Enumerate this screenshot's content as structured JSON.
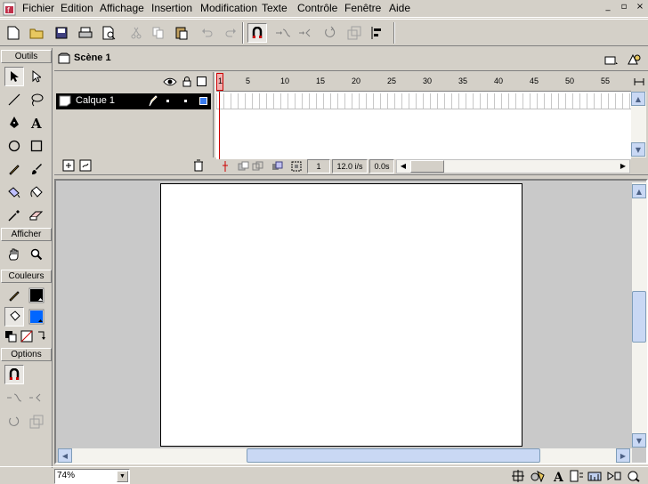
{
  "menu": {
    "items": [
      "Fichier",
      "Edition",
      "Affichage",
      "Insertion",
      "Modification",
      "Texte",
      "Contrôle",
      "Fenêtre",
      "Aide"
    ]
  },
  "window_controls": {
    "minimize": "_",
    "restore": "▫",
    "close": "×"
  },
  "toolbar": {
    "buttons": [
      "new-icon",
      "open-icon",
      "save-icon",
      "print-icon",
      "print-preview-icon",
      "cut-icon",
      "copy-icon",
      "paste-icon",
      "undo-icon",
      "redo-icon",
      "snap-magnet-icon",
      "smooth-icon",
      "straighten-icon",
      "rotate-icon",
      "scale-icon",
      "align-icon"
    ]
  },
  "tools": {
    "sections": {
      "outils": "Outils",
      "afficher": "Afficher",
      "couleurs": "Couleurs",
      "options": "Options"
    },
    "stroke_color": "#000000",
    "fill_color": "#0066ff"
  },
  "scene": {
    "label": "Scène 1"
  },
  "timeline": {
    "layer_name": "Calque 1",
    "frame_ticks": [
      "1",
      "5",
      "10",
      "15",
      "20",
      "25",
      "30",
      "35",
      "40",
      "45",
      "50",
      "55"
    ],
    "current_frame": "1",
    "frame_rate": "12.0 i/s",
    "elapsed": "0.0s"
  },
  "statusbar": {
    "zoom": "74%"
  }
}
